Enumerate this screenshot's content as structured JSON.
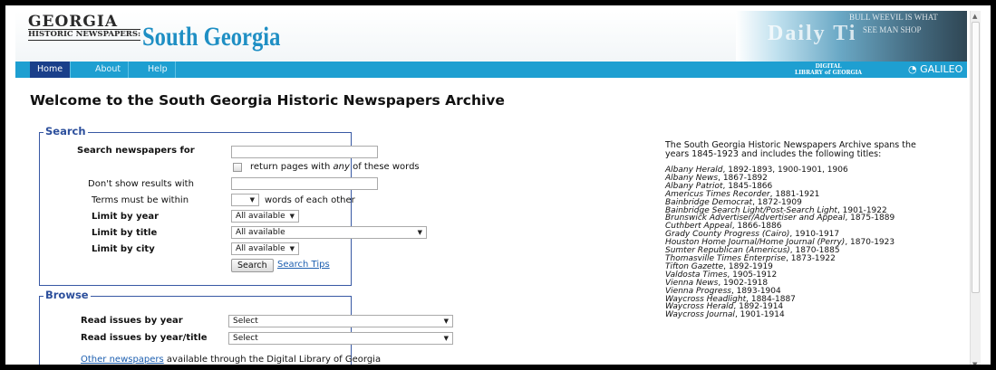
{
  "header": {
    "logo_top": "GEORGIA",
    "logo_bottom": "HISTORIC NEWSPAPERS:",
    "site_title": "South Georgia",
    "masthead_text": "Daily Ti",
    "masthead_headline_1": "BULL WEEVIL IS WHAT",
    "masthead_headline_2": "SEE MAN SHOP",
    "dlg_logo_line1": "DIGITAL",
    "dlg_logo_line2": "LIBRARY of GEORGIA",
    "galileo": "GALILEO"
  },
  "nav": {
    "home": "Home",
    "about": "About",
    "help": "Help"
  },
  "page_title": "Welcome to the South Georgia Historic Newspapers Archive",
  "search": {
    "legend": "Search",
    "search_for_label": "Search newspapers for",
    "any_words_pre": "return pages with ",
    "any_words_em": "any",
    "any_words_post": " of these words",
    "exclude_label": "Don't show results with",
    "proximity_label": "Terms must be within",
    "proximity_suffix": "words of each other",
    "year_label": "Limit by year",
    "year_value": "All available",
    "title_label": "Limit by title",
    "title_value": "All available",
    "city_label": "Limit by city",
    "city_value": "All available",
    "search_button": "Search",
    "tips_link": "Search Tips"
  },
  "browse": {
    "legend": "Browse",
    "by_year_label": "Read issues by year",
    "by_year_value": "Select",
    "by_year_title_label": "Read issues by year/title",
    "by_year_title_value": "Select",
    "other_link": "Other newspapers",
    "other_suffix": " available through the Digital Library of Georgia"
  },
  "about": {
    "intro": "The South Georgia Historic Newspapers Archive spans the years 1845-1923 and includes the following titles:",
    "titles": [
      {
        "name": "Albany Herald",
        "years": ", 1892-1893, 1900-1901, 1906"
      },
      {
        "name": "Albany News",
        "years": ", 1867-1892"
      },
      {
        "name": "Albany Patriot",
        "years": ", 1845-1866"
      },
      {
        "name": "Americus Times Recorder",
        "years": ", 1881-1921"
      },
      {
        "name": "Bainbridge Democrat",
        "years": ", 1872-1909"
      },
      {
        "name": "Bainbridge Search Light/Post-Search Light",
        "years": ", 1901-1922"
      },
      {
        "name": "Brunswick Advertiser/Advertiser and Appeal",
        "years": ", 1875-1889"
      },
      {
        "name": "Cuthbert Appeal",
        "years": ", 1866-1886"
      },
      {
        "name": "Grady County Progress (Cairo)",
        "years": ", 1910-1917"
      },
      {
        "name": "Houston Home Journal/Home Journal (Perry)",
        "years": ", 1870-1923"
      },
      {
        "name": "Sumter Republican (Americus)",
        "years": ", 1870-1885"
      },
      {
        "name": "Thomasville Times Enterprise",
        "years": ", 1873-1922"
      },
      {
        "name": "Tifton Gazette",
        "years": ", 1892-1919"
      },
      {
        "name": "Valdosta Times",
        "years": ", 1905-1912"
      },
      {
        "name": "Vienna News",
        "years": ", 1902-1918"
      },
      {
        "name": "Vienna Progress",
        "years": ", 1893-1904"
      },
      {
        "name": "Waycross Headlight",
        "years": ", 1884-1887"
      },
      {
        "name": "Waycross Herald",
        "years": ", 1892-1914"
      },
      {
        "name": "Waycross Journal",
        "years": ", 1901-1914"
      }
    ]
  },
  "colors": {
    "nav_bar": "#1e9fd1",
    "nav_active": "#1a3f8a",
    "title_blue": "#1f8fc4",
    "fieldset_border": "#3758a4",
    "link": "#1d5fb0"
  }
}
